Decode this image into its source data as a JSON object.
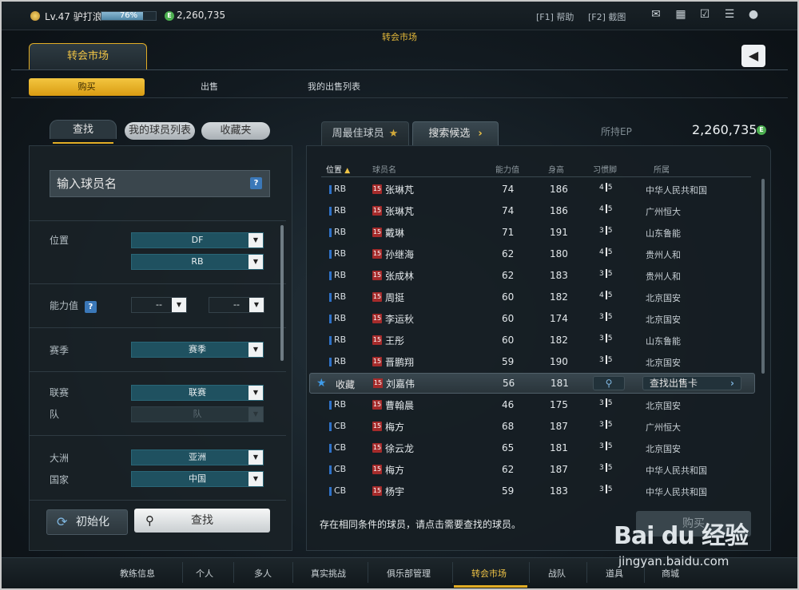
{
  "topbar": {
    "level": "Lv.47",
    "username": "驴打浪",
    "xp_percent": "76%",
    "xp_fraction": 0.76,
    "ep_balance": "2,260,735",
    "hotkeys": [
      "[F1] 帮助",
      "[F2] 截图"
    ],
    "icons": [
      "mail-icon",
      "grid-icon",
      "calendar-check-icon",
      "chat-icon",
      "user-icon"
    ]
  },
  "market_title": "转会市场",
  "main_tab": "转会市场",
  "subtabs": [
    "购买",
    "出售",
    "我的出售列表"
  ],
  "left": {
    "tabs": [
      "查找",
      "我的球员列表",
      "收藏夹"
    ],
    "name_placeholder": "输入球员名",
    "filters": {
      "position_label": "位置",
      "position_value_1": "DF",
      "position_value_2": "RB",
      "ovr_label": "能力值",
      "ovr_min": "--",
      "ovr_max": "--",
      "season_label": "赛季",
      "season_value": "赛季",
      "league_label": "联赛",
      "league_value": "联赛",
      "team_label": "队",
      "team_value": "队",
      "continent_label": "大洲",
      "continent_value": "亚洲",
      "country_label": "国家",
      "country_value": "中国"
    },
    "reset_label": "初始化",
    "search_label": "查找"
  },
  "right": {
    "tabs": [
      "周最佳球员",
      "搜索候选"
    ],
    "ep_label": "所持EP",
    "ep_value": "2,260,735",
    "headers": [
      "位置",
      "球员名",
      "能力值",
      "身高",
      "习惯脚",
      "所属"
    ],
    "rows": [
      {
        "pos": "RB",
        "badge": "15",
        "name": "张琳芃",
        "ovr": "74",
        "height": "186",
        "foot_l": "4",
        "foot_r": "5",
        "club": "中华人民共和国"
      },
      {
        "pos": "RB",
        "badge": "15",
        "name": "张琳芃",
        "ovr": "74",
        "height": "186",
        "foot_l": "4",
        "foot_r": "5",
        "club": "广州恒大"
      },
      {
        "pos": "RB",
        "badge": "15",
        "name": "戴琳",
        "ovr": "71",
        "height": "191",
        "foot_l": "3",
        "foot_r": "5",
        "club": "山东鲁能"
      },
      {
        "pos": "RB",
        "badge": "15",
        "name": "孙继海",
        "ovr": "62",
        "height": "180",
        "foot_l": "4",
        "foot_r": "5",
        "club": "贵州人和"
      },
      {
        "pos": "RB",
        "badge": "15",
        "name": "张成林",
        "ovr": "62",
        "height": "183",
        "foot_l": "3",
        "foot_r": "5",
        "club": "贵州人和"
      },
      {
        "pos": "RB",
        "badge": "15",
        "name": "周挺",
        "ovr": "60",
        "height": "182",
        "foot_l": "4",
        "foot_r": "5",
        "club": "北京国安"
      },
      {
        "pos": "RB",
        "badge": "15",
        "name": "李运秋",
        "ovr": "60",
        "height": "174",
        "foot_l": "3",
        "foot_r": "5",
        "club": "北京国安"
      },
      {
        "pos": "RB",
        "badge": "15",
        "name": "王彤",
        "ovr": "60",
        "height": "182",
        "foot_l": "3",
        "foot_r": "5",
        "club": "山东鲁能"
      },
      {
        "pos": "RB",
        "badge": "15",
        "name": "晋鹏翔",
        "ovr": "59",
        "height": "190",
        "foot_l": "3",
        "foot_r": "5",
        "club": "北京国安"
      },
      {
        "pos": "",
        "badge": "15",
        "name": "刘嘉伟",
        "ovr": "56",
        "height": "181",
        "foot_l": "",
        "foot_r": "",
        "club": ""
      },
      {
        "pos": "RB",
        "badge": "15",
        "name": "曹翰晨",
        "ovr": "46",
        "height": "175",
        "foot_l": "3",
        "foot_r": "5",
        "club": "北京国安"
      },
      {
        "pos": "CB",
        "badge": "15",
        "name": "梅方",
        "ovr": "68",
        "height": "187",
        "foot_l": "3",
        "foot_r": "5",
        "club": "广州恒大"
      },
      {
        "pos": "CB",
        "badge": "15",
        "name": "徐云龙",
        "ovr": "65",
        "height": "181",
        "foot_l": "3",
        "foot_r": "5",
        "club": "北京国安"
      },
      {
        "pos": "CB",
        "badge": "15",
        "name": "梅方",
        "ovr": "62",
        "height": "187",
        "foot_l": "3",
        "foot_r": "5",
        "club": "中华人民共和国"
      },
      {
        "pos": "CB",
        "badge": "15",
        "name": "杨宇",
        "ovr": "59",
        "height": "183",
        "foot_l": "3",
        "foot_r": "5",
        "club": "中华人民共和国"
      }
    ],
    "selected": {
      "fav_label": "收藏",
      "find_label": "查找出售卡"
    },
    "status_message": "存在相同条件的球员，请点击需要查找的球员。",
    "buy_label": "购买"
  },
  "bottom_nav": [
    "教练信息",
    "个人",
    "多人",
    "真实挑战",
    "俱乐部管理",
    "转会市场",
    "战队",
    "道具",
    "商城"
  ],
  "watermark": {
    "logo": "Bai du 经验",
    "url": "jingyan.baidu.com"
  }
}
